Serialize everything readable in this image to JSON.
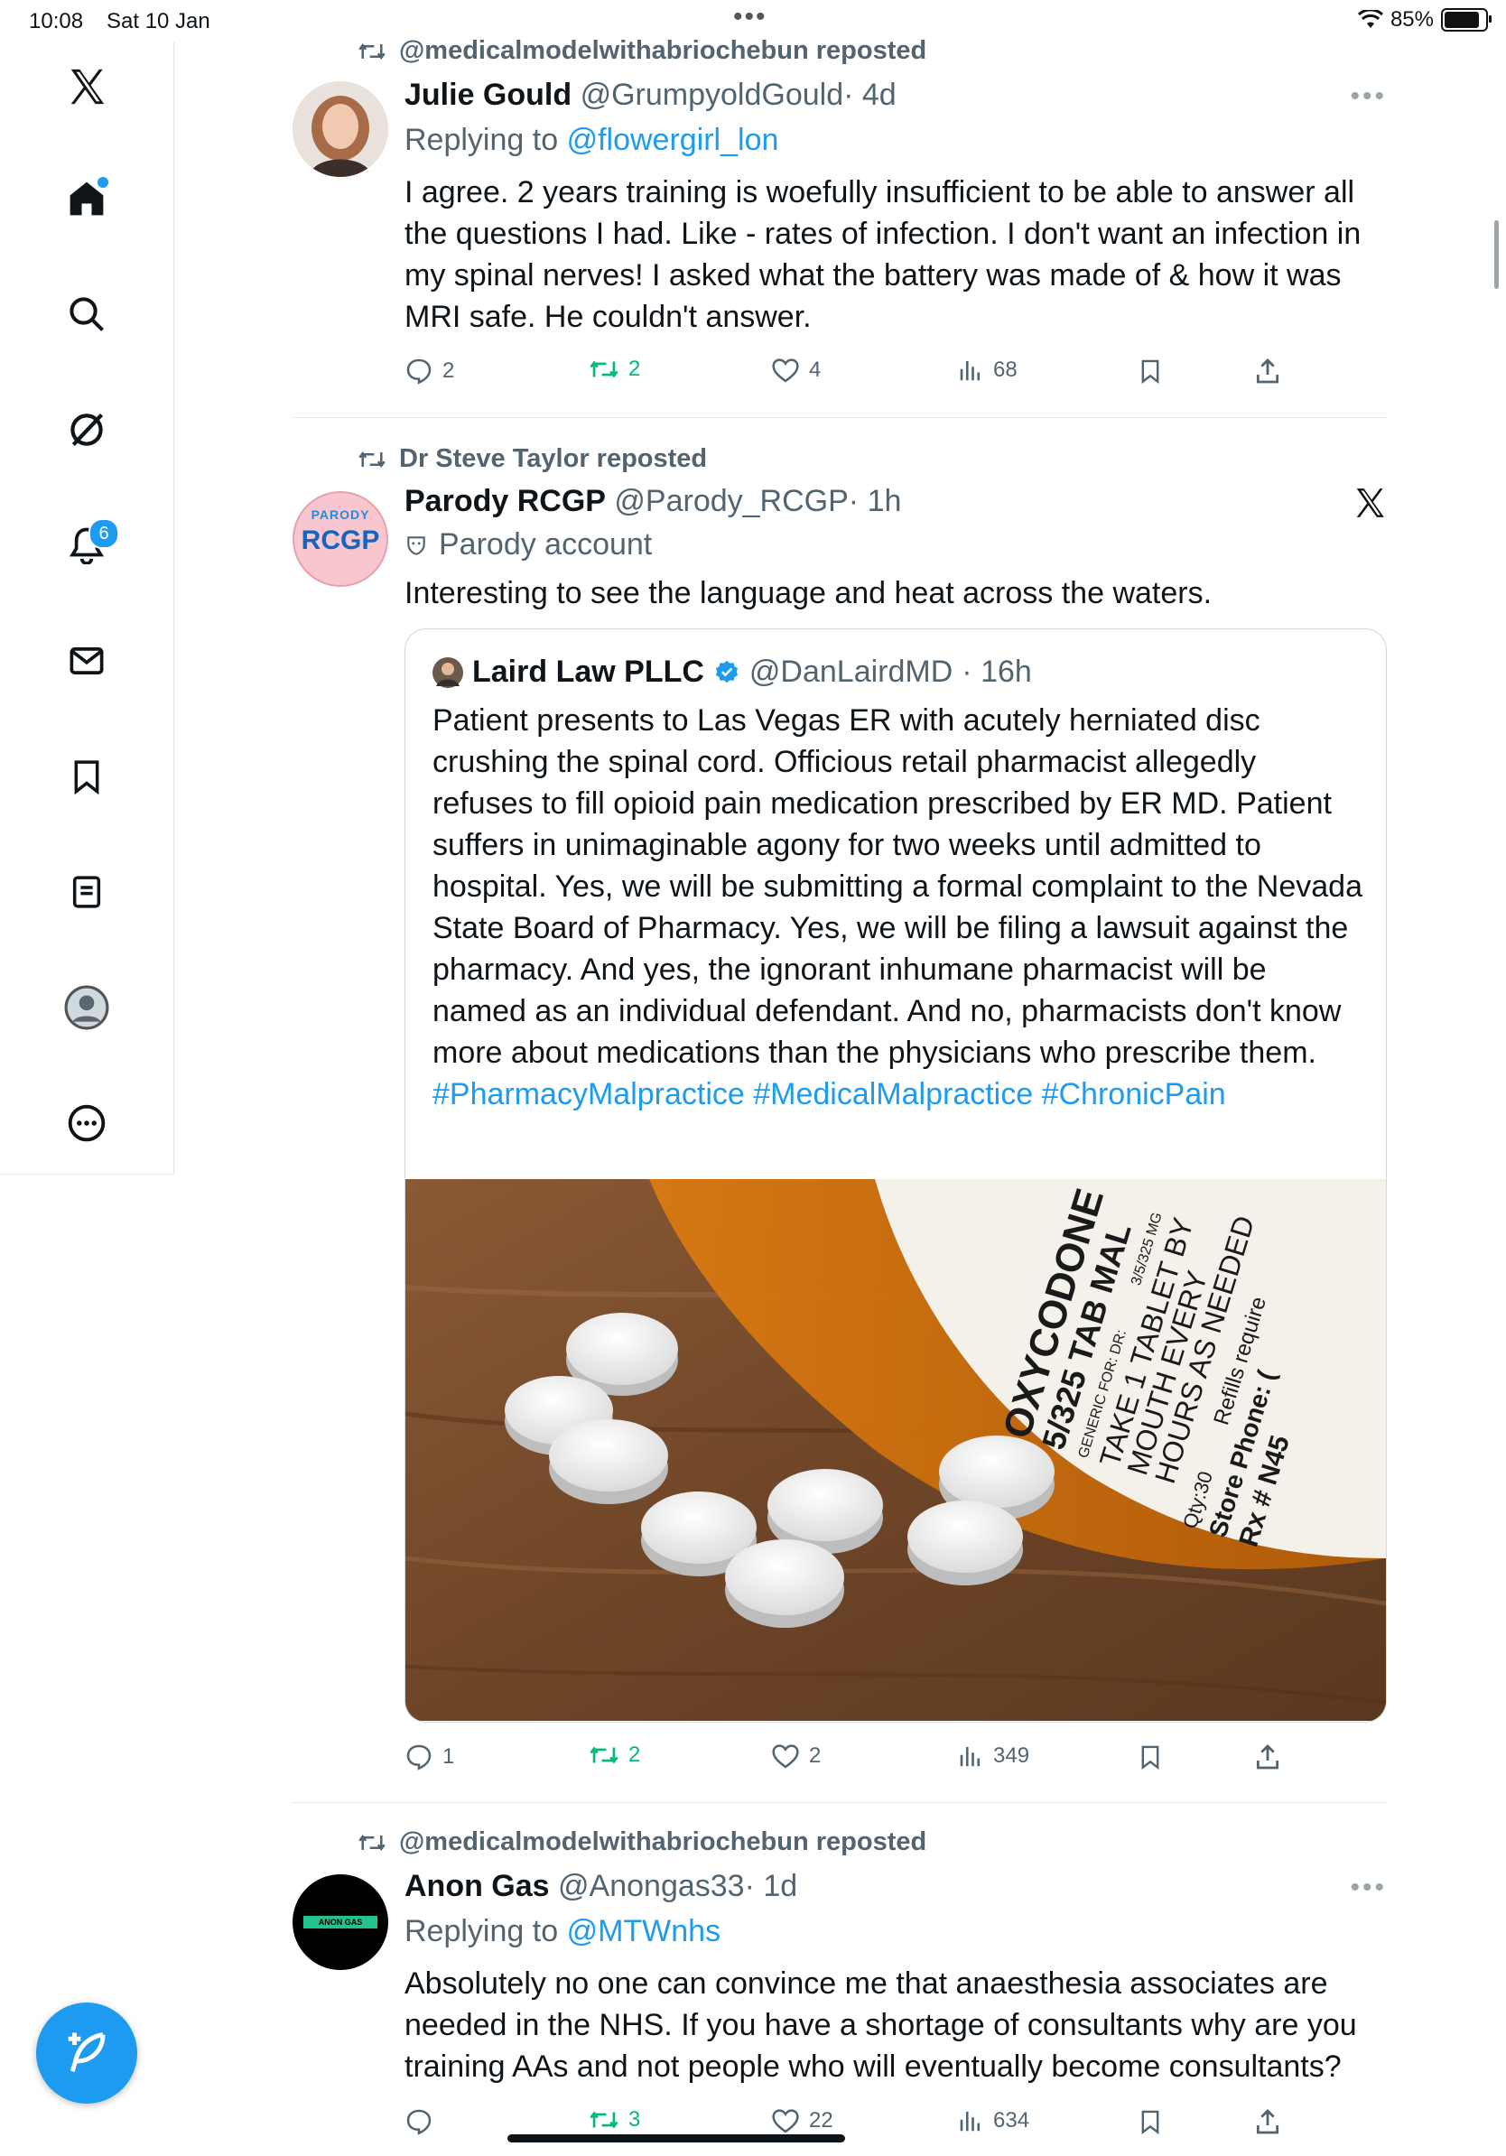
{
  "status_bar": {
    "time": "10:08",
    "date": "Sat 10 Jan",
    "battery": "85%"
  },
  "sidebar": {
    "items": [
      {
        "name": "x-logo"
      },
      {
        "name": "home",
        "has_dot": true
      },
      {
        "name": "search"
      },
      {
        "name": "grok"
      },
      {
        "name": "notifications",
        "badge": "6"
      },
      {
        "name": "messages"
      },
      {
        "name": "bookmarks"
      },
      {
        "name": "lists"
      },
      {
        "name": "profile"
      },
      {
        "name": "more"
      }
    ],
    "compose_label": "Post"
  },
  "posts": [
    {
      "repost_by": "@medicalmodelwithabriochebun reposted",
      "name": "Julie Gould",
      "handle": "@GrumpyoldGould",
      "time": "· 4d",
      "reply_prefix": "Replying to",
      "reply_handle": "@flowergirl_lon",
      "text": "I agree. 2 years training is woefully insufficient to be able to answer all the questions I had. Like - rates of infection. I don't want an infection in my spinal nerves! I asked what the battery was made of & how it was MRI safe. He couldn't answer.",
      "replies": "2",
      "reposts": "2",
      "likes": "4",
      "views": "68"
    },
    {
      "repost_by": "Dr Steve Taylor reposted",
      "name": "Parody RCGP",
      "handle": "@Parody_RCGP",
      "time": "· 1h",
      "avatar_top": "PARODY",
      "avatar_main": "RCGP",
      "parody_label": "Parody account",
      "text": "Interesting to see the language and heat across the waters.",
      "quote": {
        "name": "Laird Law PLLC",
        "handle": "@DanLairdMD",
        "time": "· 16h",
        "text": "Patient presents to Las Vegas ER with acutely herniated disc crushing the spinal cord. Officious retail pharmacist allegedly refuses to fill opioid pain medication prescribed by ER MD. Patient suffers in unimaginable agony for two weeks until admitted to hospital. Yes, we will be submitting a formal complaint to the Nevada State Board of Pharmacy. Yes, we will be filing a lawsuit against the pharmacy. And yes, the ignorant inhumane pharmacist will be named as an individual defendant. And no, pharmacists don't know more about medications than the physicians who prescribe them.",
        "hashtags": "#PharmacyMalpractice #MedicalMalpractice #ChronicPain",
        "label": {
          "line1": "OXYCODONE",
          "line2": "5/325 TAB MAL",
          "line3": "3/5/325 MG",
          "line4": "GENERIC FOR: DR:",
          "line5": "TAKE 1 TABLET BY",
          "line6": "MOUTH EVERY",
          "line7": "HOURS AS NEEDED",
          "line8": "Qty:30",
          "line9": "Refills require",
          "line10": "Store Phone: (",
          "line11": "Rx # N45"
        }
      },
      "replies": "1",
      "reposts": "2",
      "likes": "2",
      "views": "349"
    },
    {
      "repost_by": "@medicalmodelwithabriochebun reposted",
      "name": "Anon Gas",
      "handle": "@Anongas33",
      "time": "· 1d",
      "avatar_text": "ANON GAS",
      "reply_prefix": "Replying to",
      "reply_handle": "@MTWnhs",
      "text": "Absolutely no one can convince me that anaesthesia associates are needed in the NHS. If you have a shortage of consultants why are you training AAs and not people who will eventually become consultants?",
      "replies": "",
      "reposts": "3",
      "likes": "22",
      "views": "634"
    }
  ],
  "colors": {
    "accent": "#1d9bf0",
    "repost_green": "#00ba7c",
    "secondary_text": "#536471"
  }
}
